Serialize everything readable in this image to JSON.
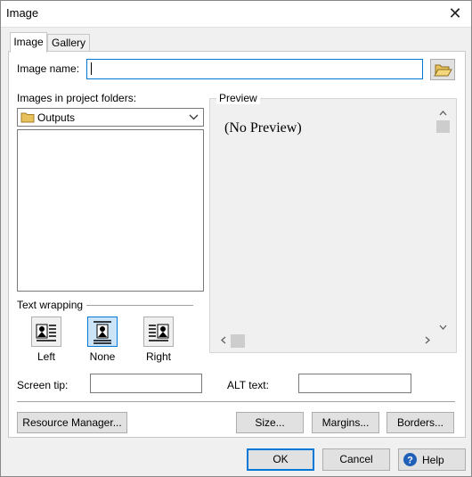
{
  "window": {
    "title": "Image",
    "close_glyph": "✕"
  },
  "tabs": [
    {
      "label": "Image",
      "active": true
    },
    {
      "label": "Gallery",
      "active": false
    }
  ],
  "image_name": {
    "label": "Image name:",
    "value": ""
  },
  "project_folders": {
    "label": "Images in project folders:",
    "selected_folder": "Outputs",
    "items": []
  },
  "preview": {
    "legend": "Preview",
    "text": "(No Preview)"
  },
  "text_wrapping": {
    "heading": "Text wrapping",
    "options": [
      {
        "label": "Left",
        "selected": false
      },
      {
        "label": "None",
        "selected": true
      },
      {
        "label": "Right",
        "selected": false
      }
    ]
  },
  "screen_tip": {
    "label": "Screen tip:",
    "value": ""
  },
  "alt_text": {
    "label": "ALT text:",
    "value": ""
  },
  "buttons": {
    "resource_manager": "Resource Manager...",
    "size": "Size...",
    "margins": "Margins...",
    "borders": "Borders...",
    "ok": "OK",
    "cancel": "Cancel",
    "help": "Help"
  },
  "icons": {
    "browse": "folder-open-icon",
    "folder": "folder-icon",
    "dropdown": "chevron-down-icon",
    "help": "help-icon"
  },
  "colors": {
    "accent": "#0078d7",
    "folder": "#e8c15c",
    "help_blue": "#1f5fb8"
  }
}
